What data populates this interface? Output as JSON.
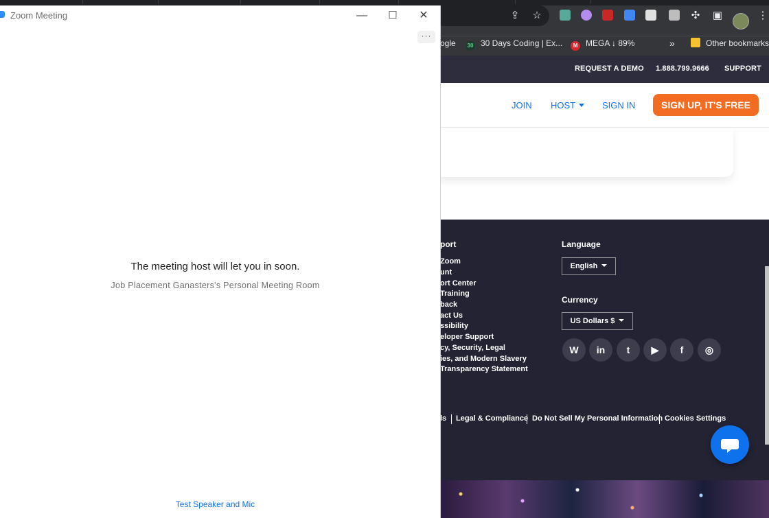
{
  "zoom_window": {
    "title": "Zoom Meeting",
    "minimize_glyph": "—",
    "maximize_glyph": "☐",
    "close_glyph": "✕",
    "more_glyph": "···",
    "message": "The meeting host will let you in soon.",
    "room_name": "Job Placement Ganasters's Personal Meeting Room",
    "test_link": "Test Speaker and Mic"
  },
  "browser": {
    "bookmarks": {
      "item1": "ogle",
      "item2": "30 Days Coding | Ex...",
      "item2_icon": "30",
      "item3": "MEGA ↓ 89%",
      "item3_icon": "M",
      "overflow": "»",
      "other": "Other bookmarks"
    },
    "icons": [
      "share-icon",
      "star-icon",
      "puzzle-icon",
      "sidebar-icon",
      "menu-icon"
    ]
  },
  "zoom_site": {
    "topbar": {
      "request_demo": "REQUEST A DEMO",
      "phone": "1.888.799.9666",
      "support": "SUPPORT"
    },
    "nav": {
      "join": "JOIN",
      "host": "HOST",
      "sign_in": "SIGN IN",
      "sign_up": "SIGN UP, IT'S FREE"
    },
    "footer": {
      "support_heading": "port",
      "support_links": [
        "Zoom",
        "unt",
        "ort Center",
        "Training",
        "back",
        "act Us",
        "ssibility",
        "eloper Support",
        "cy, Security, Legal",
        "ies, and Modern Slavery",
        "Transparency Statement"
      ],
      "language_heading": "Language",
      "language_value": "English",
      "currency_heading": "Currency",
      "currency_value": "US Dollars $",
      "legal_links": [
        "ls",
        "Legal & Compliance",
        "Do Not Sell My Personal Information",
        "Cookies Settings"
      ]
    }
  },
  "colors": {
    "zoom_blue": "#0e72ed",
    "signup_orange": "#f26d21",
    "footer_bg": "#232333",
    "topbar_bg": "#2d2d3e"
  }
}
